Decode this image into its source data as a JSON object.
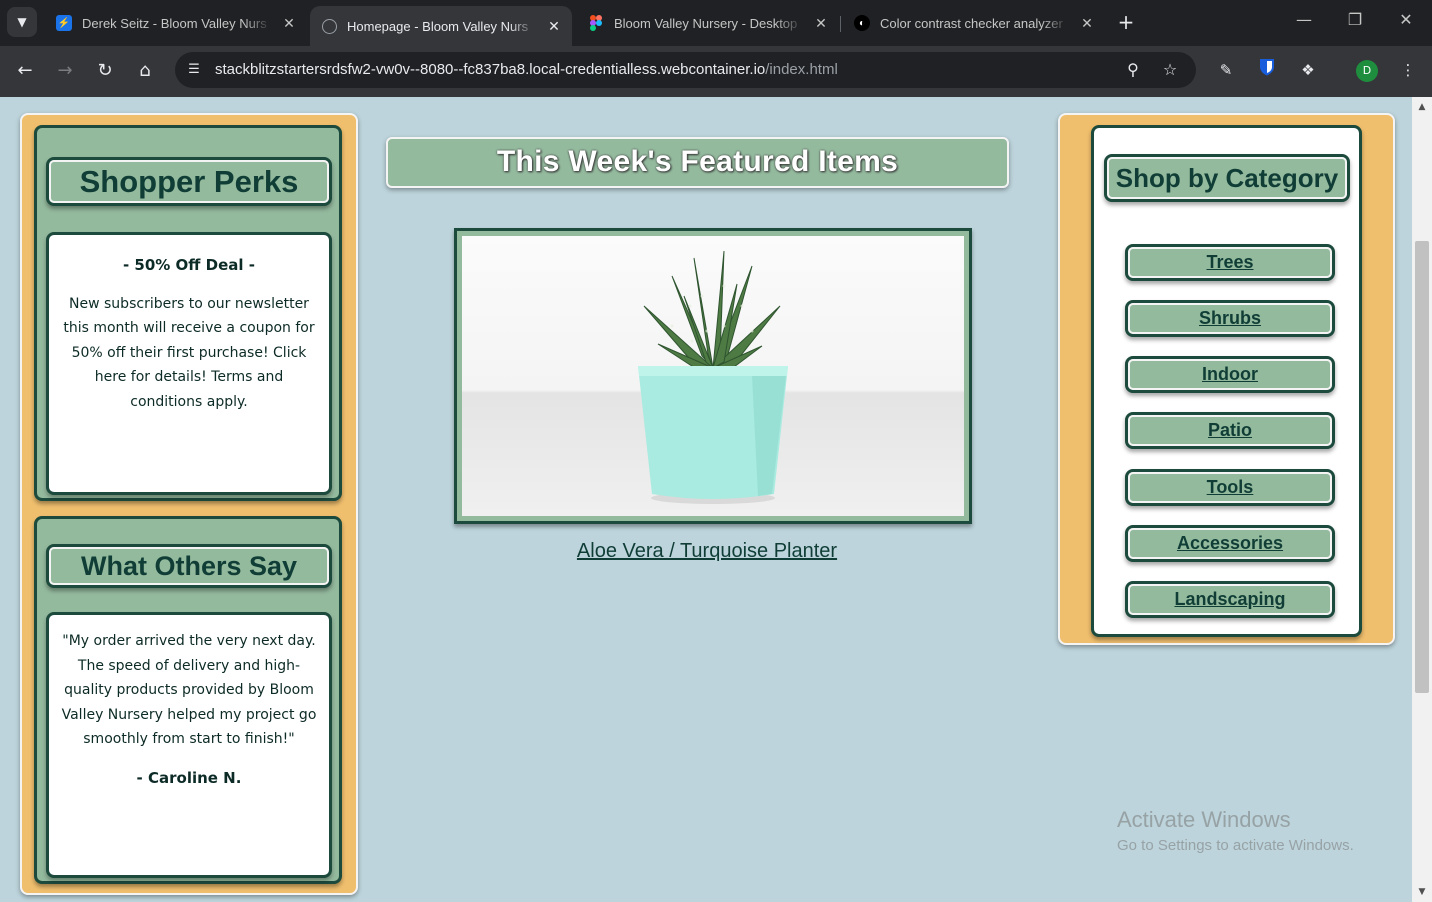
{
  "browser": {
    "tabs": [
      {
        "title": "Derek Seitz - Bloom Valley Nurs",
        "favicon": "bolt-icon",
        "favicon_color": "#1a73e8"
      },
      {
        "title": "Homepage - Bloom Valley Nurs",
        "favicon": "globe-icon",
        "favicon_color": "#9aa0a6"
      },
      {
        "title": "Bloom Valley Nursery - Desktop",
        "favicon": "figma-icon",
        "favicon_color": "#f24e1e"
      },
      {
        "title": "Color contrast checker analyzer",
        "favicon": "contrast-icon",
        "favicon_color": "#ffffff"
      }
    ],
    "url_host": "stackblitzstartersrdsfw2-vw0v--8080--fc837ba8.local-credentialless.webcontainer.io",
    "url_path": "/index.html",
    "profile_initial": "D"
  },
  "page": {
    "perks": {
      "title": "Shopper Perks",
      "deal_heading": "- 50% Off Deal -",
      "deal_text": "New subscribers to our newsletter this month will receive a coupon for 50% off their first purchase! Click here for details! Terms and conditions apply."
    },
    "reviews": {
      "title": "What Others Say",
      "quote": "\"My order arrived the very next day. The speed of delivery and high-quality products provided by Bloom Valley Nursery helped my project go smoothly from start to finish!\"",
      "author": "- Caroline N."
    },
    "featured": {
      "title": "This Week's Featured Items",
      "product_name": "Aloe Vera / Turquoise Planter"
    },
    "categories": {
      "title": "Shop by Category",
      "items": [
        "Trees",
        "Shrubs",
        "Indoor",
        "Patio",
        "Tools",
        "Accessories",
        "Landscaping"
      ]
    },
    "watermark": {
      "line1": "Activate Windows",
      "line2": "Go to Settings to activate Windows."
    }
  },
  "colors": {
    "background": "#bdd4dc",
    "accent_gold": "#f0bf6e",
    "sage": "#94ba9e",
    "dark_green": "#1c4a3c"
  }
}
